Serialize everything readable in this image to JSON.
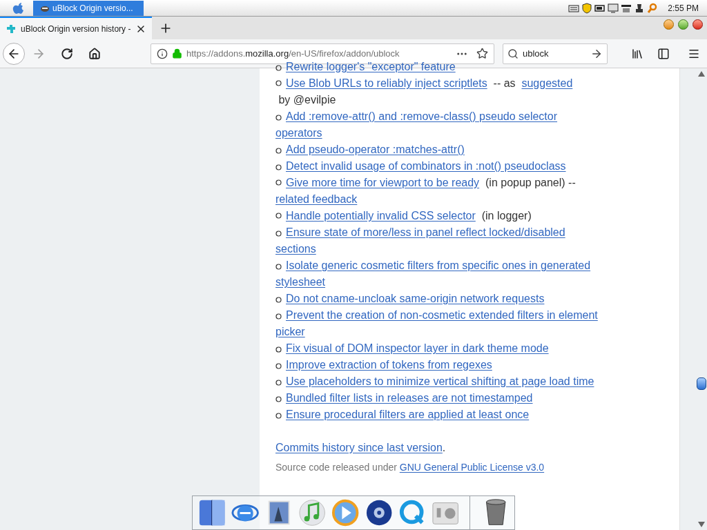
{
  "menubar": {
    "window_button": "uBlock Origin versio...",
    "clock": "2:55 PM"
  },
  "tab": {
    "title": "uBlock Origin version history -"
  },
  "address_bar": {
    "url_prefix": "https://addons.",
    "url_host": "mozilla.org",
    "url_path": "/en-US/firefox/addon/ublock"
  },
  "search_field": {
    "value": "ublock"
  },
  "changelog": [
    {
      "parts": [
        {
          "kind": "link",
          "text": "Rewrite logger's \"exceptor\" feature"
        }
      ]
    },
    {
      "parts": [
        {
          "kind": "link",
          "text": "Use Blob URLs to reliably inject scriptlets"
        },
        {
          "kind": "plain",
          "text": " -- as "
        },
        {
          "kind": "link",
          "text": "suggested"
        },
        {
          "kind": "plain",
          "text": " by @evilpie"
        }
      ]
    },
    {
      "parts": [
        {
          "kind": "link",
          "text": "Add :remove-attr() and :remove-class() pseudo selector operators"
        }
      ]
    },
    {
      "parts": [
        {
          "kind": "link",
          "text": "Add pseudo-operator :matches-attr()"
        }
      ]
    },
    {
      "parts": [
        {
          "kind": "link",
          "text": "Detect invalid usage of combinators in :not() pseudoclass"
        }
      ]
    },
    {
      "parts": [
        {
          "kind": "link",
          "text": "Give more time for viewport to be ready"
        },
        {
          "kind": "plain",
          "text": " (in popup panel) -- "
        },
        {
          "kind": "link",
          "text": "related feedback"
        }
      ]
    },
    {
      "parts": [
        {
          "kind": "link",
          "text": "Handle potentially invalid CSS selector"
        },
        {
          "kind": "plain",
          "text": " (in logger)"
        }
      ]
    },
    {
      "parts": [
        {
          "kind": "link",
          "text": "Ensure state of more/less in panel reflect locked/disabled sections"
        }
      ]
    },
    {
      "parts": [
        {
          "kind": "link",
          "text": "Isolate generic cosmetic filters from specific ones in generated stylesheet"
        }
      ]
    },
    {
      "parts": [
        {
          "kind": "link",
          "text": "Do not cname-uncloak same-origin network requests"
        }
      ]
    },
    {
      "parts": [
        {
          "kind": "link",
          "text": "Prevent the creation of non-cosmetic extended filters in element picker"
        }
      ]
    },
    {
      "parts": [
        {
          "kind": "link",
          "text": "Fix visual of DOM inspector layer in dark theme mode"
        }
      ]
    },
    {
      "parts": [
        {
          "kind": "link",
          "text": "Improve extraction of tokens from regexes"
        }
      ]
    },
    {
      "parts": [
        {
          "kind": "link",
          "text": "Use placeholders to minimize vertical shifting at page load time"
        }
      ]
    },
    {
      "parts": [
        {
          "kind": "link",
          "text": "Bundled filter lists in releases are not timestamped"
        }
      ]
    },
    {
      "parts": [
        {
          "kind": "link",
          "text": "Ensure procedural filters are applied at least once"
        }
      ]
    }
  ],
  "commits": {
    "parts": [
      {
        "kind": "link",
        "text": "Commits history since last version"
      },
      {
        "kind": "plain",
        "text": "."
      }
    ]
  },
  "license": {
    "parts": [
      {
        "kind": "plain",
        "text": "Source code released under "
      },
      {
        "kind": "link",
        "text": "GNU General Public License v3.0"
      }
    ]
  }
}
